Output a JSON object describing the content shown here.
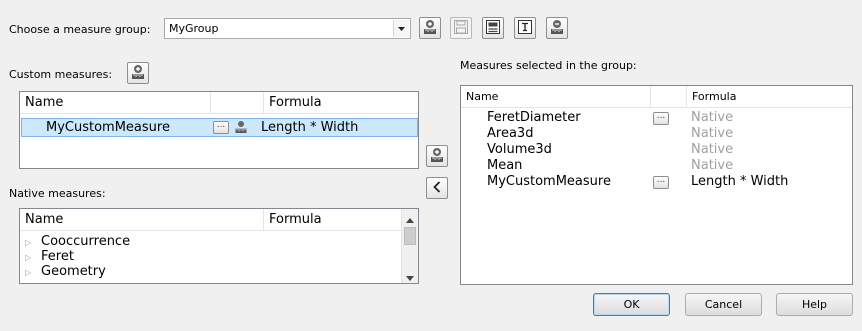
{
  "top": {
    "choose_label": "Choose a measure group:",
    "group_value": "MyGroup",
    "toolbar_icons": [
      "add-measure-icon",
      "save-icon",
      "calculator-icon",
      "text-icon",
      "delete-measure-icon"
    ]
  },
  "custom": {
    "label": "Custom measures:",
    "headers": {
      "name": "Name",
      "formula": "Formula"
    },
    "rows": [
      {
        "name": "MyCustomMeasure",
        "formula": "Length * Width"
      }
    ]
  },
  "native": {
    "label": "Native measures:",
    "headers": {
      "name": "Name",
      "formula": "Formula"
    },
    "items": [
      "Cooccurrence",
      "Feret",
      "Geometry"
    ]
  },
  "selected": {
    "label": "Measures selected in the group:",
    "headers": {
      "name": "Name",
      "formula": "Formula"
    },
    "rows": [
      {
        "name": "FeretDiameter",
        "formula": "Native"
      },
      {
        "name": "Area3d",
        "formula": "Native"
      },
      {
        "name": "Volume3d",
        "formula": "Native"
      },
      {
        "name": "Mean",
        "formula": "Native"
      },
      {
        "name": "MyCustomMeasure",
        "formula": "Length * Width"
      }
    ]
  },
  "buttons": {
    "ok": "OK",
    "cancel": "Cancel",
    "help": "Help"
  },
  "colors": {
    "selection": "#cce8ff",
    "selection_border": "#7eb4ea",
    "native_text": "#a0a0a0"
  }
}
